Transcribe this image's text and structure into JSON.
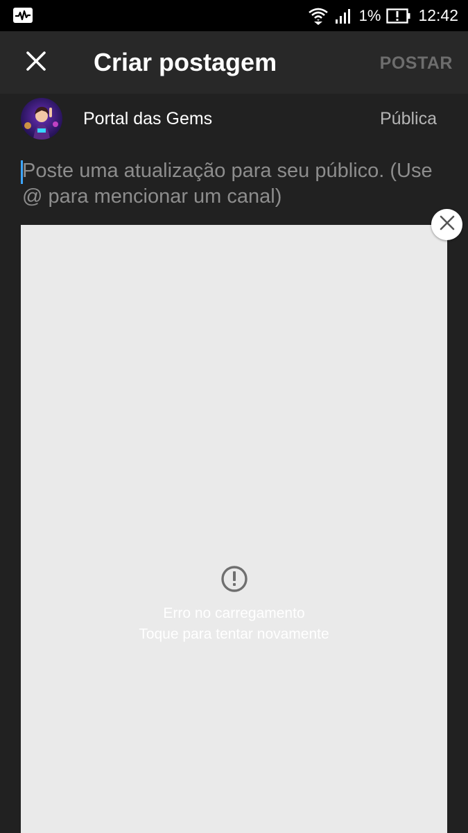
{
  "status_bar": {
    "battery": "1%",
    "time": "12:42",
    "left_icon": "activity-monitor-icon",
    "icons": [
      "wifi-icon",
      "signal-icon",
      "battery-alert-icon"
    ]
  },
  "app_bar": {
    "title": "Criar postagem",
    "post_label": "POSTAR",
    "close_icon": "close-icon"
  },
  "account": {
    "channel_name": "Portal das Gems",
    "visibility": "Pública"
  },
  "composer": {
    "placeholder": "Poste uma atualização para seu público. (Use @ para mencionar um canal)",
    "value": ""
  },
  "image_attachment": {
    "error_title": "Erro no carregamento",
    "error_action": "Toque para tentar novamente",
    "error_icon": "error-circle-icon",
    "remove_icon": "close-icon"
  },
  "colors": {
    "background": "#212121",
    "app_bar": "#282828",
    "accent_caret": "#3ea6ff",
    "disabled_text": "#6d6d6d",
    "image_placeholder": "#eaeaea"
  }
}
